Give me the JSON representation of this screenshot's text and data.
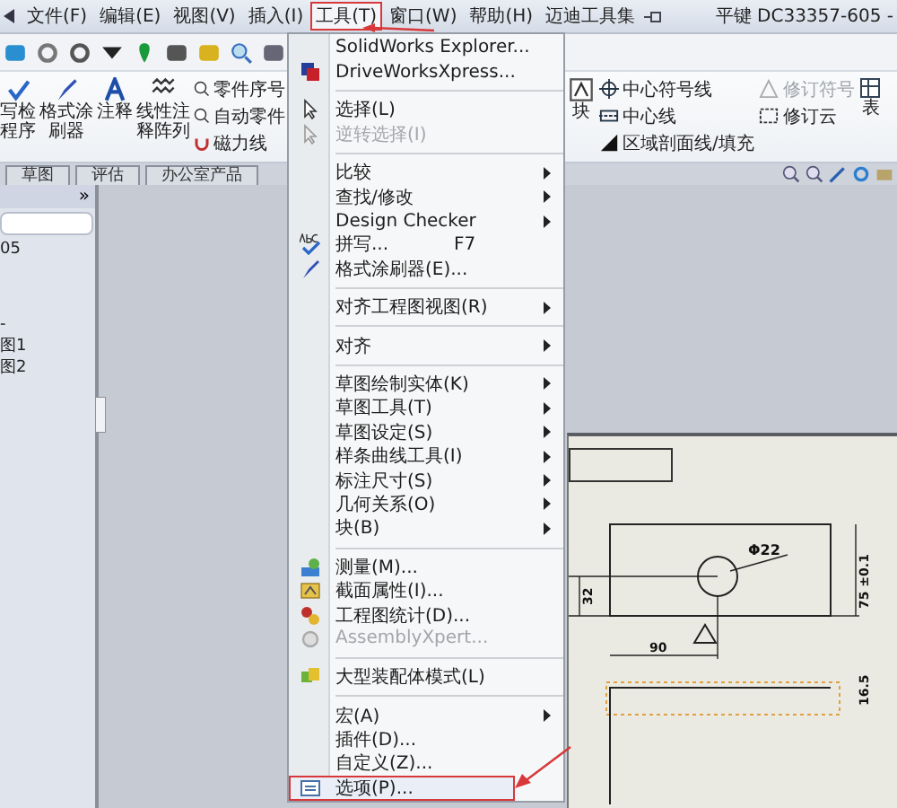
{
  "menubar": {
    "items": [
      {
        "label": "文件(F)",
        "selected": false
      },
      {
        "label": "编辑(E)",
        "selected": false
      },
      {
        "label": "视图(V)",
        "selected": false
      },
      {
        "label": "插入(I)",
        "selected": false
      },
      {
        "label": "工具(T)",
        "selected": true
      },
      {
        "label": "窗口(W)",
        "selected": false
      },
      {
        "label": "帮助(H)",
        "selected": false
      },
      {
        "label": "迈迪工具集",
        "selected": false
      }
    ],
    "title": "平键 DC33357-605 -"
  },
  "ribbon": {
    "left_large": [
      {
        "label": "写检程序"
      },
      {
        "label": "格式涂刷器"
      },
      {
        "label": "注释"
      },
      {
        "label": "线性注释阵列"
      }
    ],
    "left_small": [
      {
        "label": "零件序号"
      },
      {
        "label": "自动零件"
      },
      {
        "label": "磁力线"
      }
    ],
    "block": {
      "label": "块"
    },
    "right_small": [
      {
        "label": "中心符号线",
        "disabled": false
      },
      {
        "label": "中心线",
        "disabled": false
      },
      {
        "label": "区域剖面线/填充",
        "disabled": false
      }
    ],
    "revision": [
      {
        "label": "修订符号",
        "disabled": true
      },
      {
        "label": "修订云",
        "disabled": false
      }
    ],
    "table": {
      "label": "表"
    }
  },
  "tabs": [
    {
      "label": "草图",
      "selected": false
    },
    {
      "label": "评估",
      "selected": false
    },
    {
      "label": "办公室产品",
      "selected": false
    }
  ],
  "left_panel": {
    "expand": "»",
    "tree": [
      {
        "label": "05"
      },
      {
        "label": "-"
      },
      {
        "label": "图1"
      },
      {
        "label": "图2"
      }
    ]
  },
  "tools_menu": [
    {
      "kind": "item",
      "label": "SolidWorks Explorer...",
      "icon": false
    },
    {
      "kind": "item",
      "label": "DriveWorksXpress...",
      "icon": true
    },
    {
      "kind": "separator"
    },
    {
      "kind": "item",
      "label": "选择(L)",
      "icon": true
    },
    {
      "kind": "item",
      "label": "逆转选择(I)",
      "icon": true,
      "disabled": true
    },
    {
      "kind": "separator"
    },
    {
      "kind": "item",
      "label": "比较",
      "submenu": true
    },
    {
      "kind": "item",
      "label": "查找/修改",
      "submenu": true
    },
    {
      "kind": "item",
      "label": "Design Checker",
      "submenu": true
    },
    {
      "kind": "item",
      "label": "拼写...",
      "shortcut": "F7",
      "icon": true
    },
    {
      "kind": "item",
      "label": "格式涂刷器(E)...",
      "icon": true
    },
    {
      "kind": "separator"
    },
    {
      "kind": "item",
      "label": "对齐工程图视图(R)",
      "submenu": true
    },
    {
      "kind": "separator"
    },
    {
      "kind": "item",
      "label": "对齐",
      "submenu": true
    },
    {
      "kind": "separator"
    },
    {
      "kind": "item",
      "label": "草图绘制实体(K)",
      "submenu": true
    },
    {
      "kind": "item",
      "label": "草图工具(T)",
      "submenu": true
    },
    {
      "kind": "item",
      "label": "草图设定(S)",
      "submenu": true
    },
    {
      "kind": "item",
      "label": "样条曲线工具(I)",
      "submenu": true
    },
    {
      "kind": "item",
      "label": "标注尺寸(S)",
      "submenu": true
    },
    {
      "kind": "item",
      "label": "几何关系(O)",
      "submenu": true
    },
    {
      "kind": "item",
      "label": "块(B)",
      "submenu": true
    },
    {
      "kind": "separator"
    },
    {
      "kind": "item",
      "label": "测量(M)...",
      "icon": true
    },
    {
      "kind": "item",
      "label": "截面属性(I)...",
      "icon": true
    },
    {
      "kind": "item",
      "label": "工程图统计(D)...",
      "icon": true
    },
    {
      "kind": "item",
      "label": "AssemblyXpert...",
      "icon": true,
      "disabled": true
    },
    {
      "kind": "separator"
    },
    {
      "kind": "item",
      "label": "大型装配体模式(L)",
      "icon": true
    },
    {
      "kind": "separator"
    },
    {
      "kind": "item",
      "label": "宏(A)",
      "submenu": true
    },
    {
      "kind": "item",
      "label": "插件(D)..."
    },
    {
      "kind": "item",
      "label": "自定义(Z)..."
    },
    {
      "kind": "item",
      "label": "选项(P)...",
      "icon": true,
      "selected": true
    }
  ],
  "drawing": {
    "diameter": "Φ22",
    "height_dim": "32",
    "width_dim": "90",
    "tolerance_dim": "75 ±0.1",
    "side_dim": "16.5"
  }
}
